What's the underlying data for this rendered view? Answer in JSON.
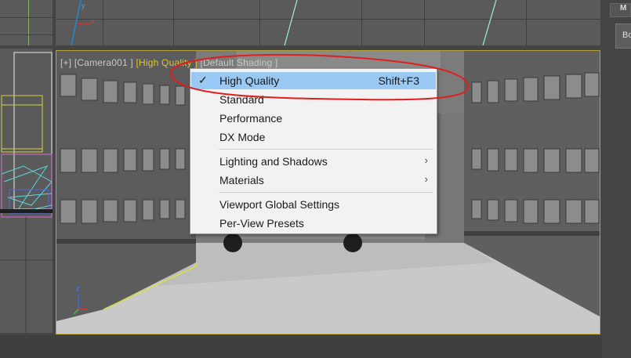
{
  "viewport": {
    "label_plus": "[+]",
    "label_camera": "[Camera001 ]",
    "label_quality": "[High Quality ]",
    "label_shading": "[Default Shading ]",
    "axis_x": "x",
    "axis_y": "y",
    "axis_z": "z"
  },
  "command_panel": {
    "tab_label": "M",
    "button_label": "Bo"
  },
  "context_menu": {
    "items": [
      {
        "label": "High Quality",
        "shortcut": "Shift+F3",
        "checked": true,
        "check_glyph": "✓"
      },
      {
        "label": "Standard"
      },
      {
        "label": "Performance"
      },
      {
        "label": "DX Mode"
      },
      {
        "label": "Lighting and Shadows",
        "submenu_glyph": "›"
      },
      {
        "label": "Materials",
        "submenu_glyph": "›"
      },
      {
        "label": "Viewport Global Settings"
      },
      {
        "label": "Per-View Presets"
      }
    ]
  },
  "colors": {
    "annotation_ellipse": "#e01e1e",
    "viewport_border": "#b5a23a",
    "menu_highlight": "#99c9f2",
    "quality_label": "#d9c43a"
  }
}
